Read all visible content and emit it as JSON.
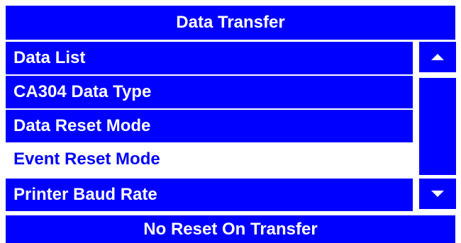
{
  "header": {
    "title": "Data Transfer"
  },
  "menu": {
    "items": [
      {
        "label": "Data List"
      },
      {
        "label": "CA304 Data Type"
      },
      {
        "label": "Data Reset Mode"
      },
      {
        "label": "Event Reset Mode"
      },
      {
        "label": "Printer Baud Rate"
      }
    ],
    "selected_index": 3
  },
  "scrollbar": {
    "up_icon": "triangle-up-icon",
    "down_icon": "triangle-down-icon"
  },
  "status": {
    "value": "No Reset On Transfer"
  },
  "colors": {
    "accent": "#0000ff",
    "text_on_accent": "#ffffff",
    "background": "#ffffff"
  }
}
